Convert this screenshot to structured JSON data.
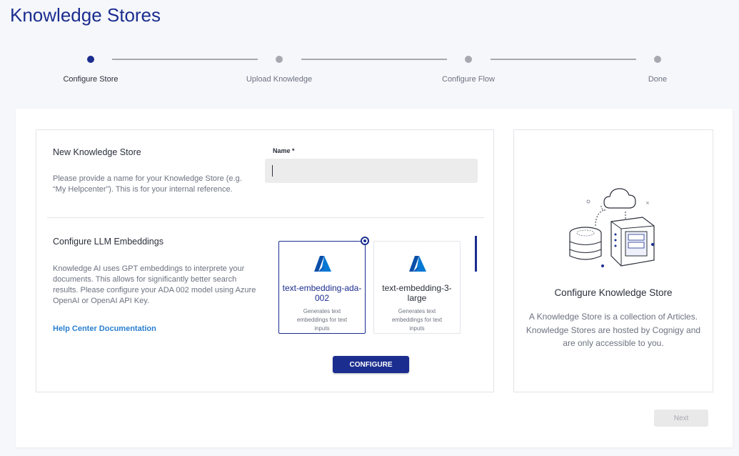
{
  "page": {
    "title": "Knowledge Stores"
  },
  "stepper": {
    "steps": [
      {
        "label": "Configure Store",
        "active": true
      },
      {
        "label": "Upload Knowledge",
        "active": false
      },
      {
        "label": "Configure Flow",
        "active": false
      },
      {
        "label": "Done",
        "active": false
      }
    ]
  },
  "store": {
    "title": "New Knowledge Store",
    "description": "Please provide a name for your Knowledge Store (e.g. “My Helpcenter”). This is for your internal reference.",
    "name_label": "Name *",
    "name_value": "",
    "name_placeholder": ""
  },
  "embeddings": {
    "title": "Configure LLM Embeddings",
    "description": "Knowledge AI uses GPT embeddings to interprete your documents. This allows for significantly better search results. Please configure your ADA 002 model using Azure OpenAI or OpenAI API Key.",
    "help_link": "Help Center Documentation",
    "models": [
      {
        "name": "text-embedding-ada-002",
        "description": "Generates text embeddings for text inputs",
        "selected": true,
        "icon": "azure-logo-icon"
      },
      {
        "name": "text-embedding-3-large",
        "description": "Generates text embeddings for text inputs",
        "selected": false,
        "icon": "azure-logo-icon"
      }
    ],
    "configure_label": "CONFIGURE"
  },
  "info": {
    "title": "Configure Knowledge Store",
    "description": "A Knowledge Store is a collection of Articles. Knowledge Stores are hosted by Cognigy and are only accessible to you.",
    "illustration_icon": "cloud-database-server-illustration"
  },
  "footer": {
    "next_label": "Next"
  },
  "colors": {
    "primary": "#1b2d8f",
    "link": "#2a7fd0",
    "muted": "#6d7280",
    "azure": "#0078d4"
  }
}
